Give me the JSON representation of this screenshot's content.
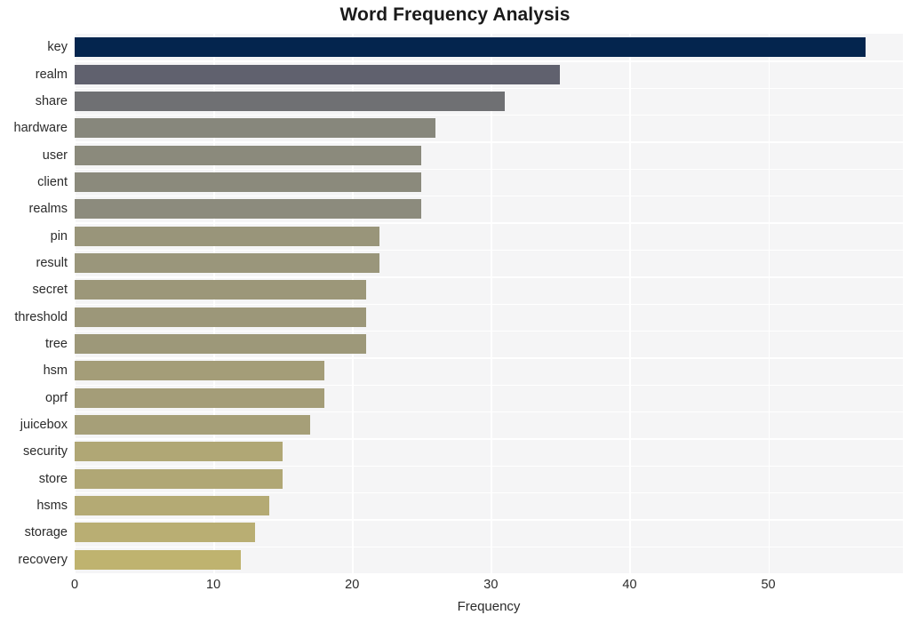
{
  "chart_data": {
    "type": "bar",
    "orientation": "horizontal",
    "title": "Word Frequency Analysis",
    "xlabel": "Frequency",
    "ylabel": "",
    "categories": [
      "key",
      "realm",
      "share",
      "hardware",
      "user",
      "client",
      "realms",
      "pin",
      "result",
      "secret",
      "threshold",
      "tree",
      "hsm",
      "oprf",
      "juicebox",
      "security",
      "store",
      "hsms",
      "storage",
      "recovery"
    ],
    "values": [
      57,
      35,
      31,
      26,
      25,
      25,
      25,
      22,
      22,
      21,
      21,
      21,
      18,
      18,
      17,
      15,
      15,
      14,
      13,
      12
    ],
    "bar_colors": [
      "#04254e",
      "#60616e",
      "#6f7073",
      "#87877c",
      "#8b8a7c",
      "#8b8a7c",
      "#8c8b7d",
      "#99957a",
      "#9a967b",
      "#9c9779",
      "#9c9779",
      "#9d9879",
      "#a49d78",
      "#a49d78",
      "#a69f78",
      "#b0a775",
      "#b0a775",
      "#b4aa74",
      "#b9ae73",
      "#bfb36f"
    ],
    "xticks": [
      0,
      10,
      20,
      30,
      40,
      50
    ],
    "xlim": [
      0,
      59.7
    ],
    "ylim_categories": 20,
    "grid": true,
    "grid_color": "#ffffff",
    "plot_background": "#f5f5f6",
    "figure_background": "#ffffff",
    "legend": null
  },
  "axis": {
    "x_tick_labels": [
      "0",
      "10",
      "20",
      "30",
      "40",
      "50"
    ],
    "y_tick_labels": [
      "key",
      "realm",
      "share",
      "hardware",
      "user",
      "client",
      "realms",
      "pin",
      "result",
      "secret",
      "threshold",
      "tree",
      "hsm",
      "oprf",
      "juicebox",
      "security",
      "store",
      "hsms",
      "storage",
      "recovery"
    ]
  }
}
